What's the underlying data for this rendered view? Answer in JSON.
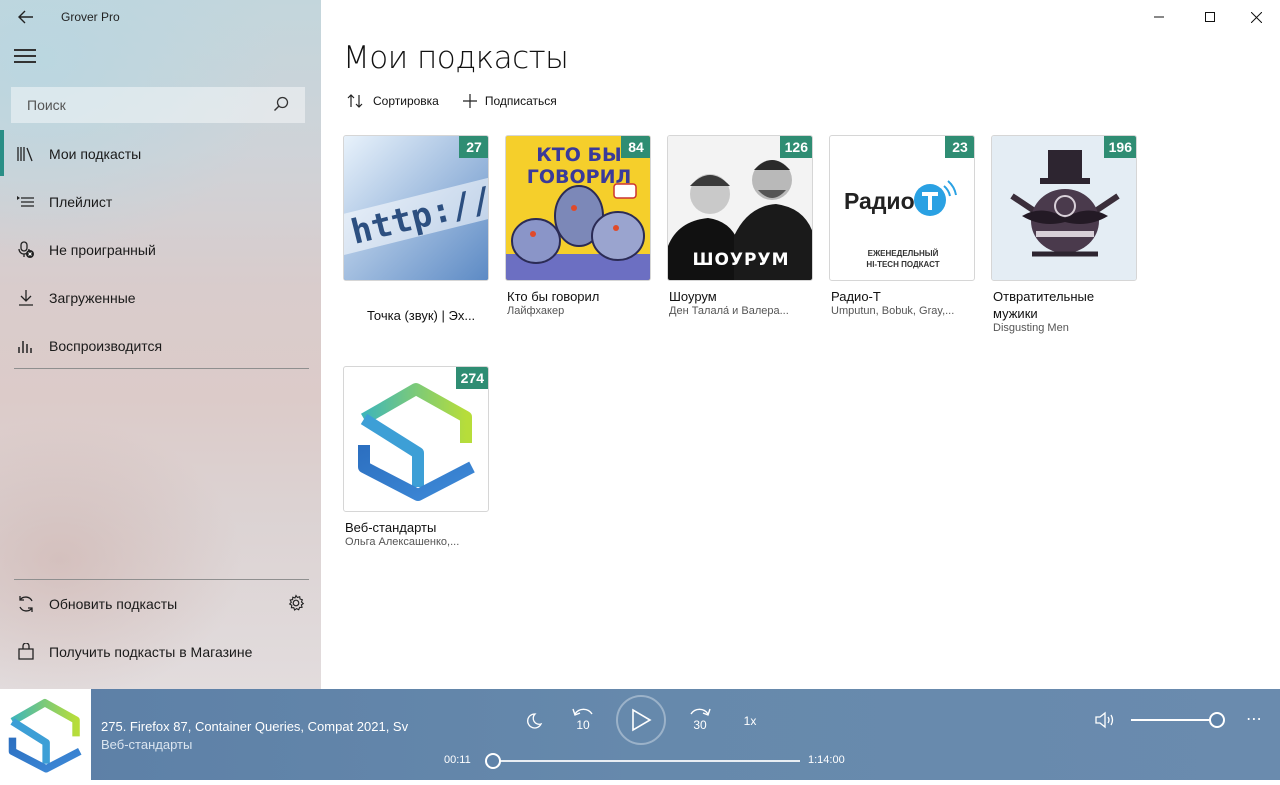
{
  "app": {
    "title": "Grover Pro"
  },
  "search": {
    "placeholder": "Поиск"
  },
  "nav": {
    "items": [
      {
        "label": "Мои подкасты",
        "icon": "library-icon"
      },
      {
        "label": "Плейлист",
        "icon": "playlist-icon"
      },
      {
        "label": "Не проигранный",
        "icon": "unplayed-icon"
      },
      {
        "label": "Загруженные",
        "icon": "download-icon"
      },
      {
        "label": "Воспроизводится",
        "icon": "equalizer-icon"
      }
    ],
    "bottom": [
      {
        "label": "Обновить подкасты",
        "icon": "refresh-icon"
      },
      {
        "label": "Получить подкасты в Магазине",
        "icon": "store-icon"
      }
    ]
  },
  "main": {
    "title": "Мои подкасты",
    "toolbar": {
      "sort_label": "Сортировка",
      "subscribe_label": "Подписаться"
    }
  },
  "podcasts": [
    {
      "title": "Точка (звук)  | Эх...",
      "subtitle": "",
      "count": "27"
    },
    {
      "title": "Кто бы говорил",
      "subtitle": "Лайфхакер",
      "count": "84",
      "cover_text": [
        "КТО БЫ",
        "ГОВОРИЛ"
      ]
    },
    {
      "title": "Шоурум",
      "subtitle": "Ден Талала́ и Валера...",
      "count": "126",
      "cover_text": "ШОУРУМ"
    },
    {
      "title": "Радио-Т",
      "subtitle": "Umputun, Bobuk, Gray,...",
      "count": "23",
      "cover_text": {
        "logo": "Радио",
        "line1": "ЕЖЕНЕДЕЛЬНЫЙ",
        "line2": "HI-TECH ПОДКАСТ"
      }
    },
    {
      "title": "Отвратительные мужики",
      "subtitle": "Disgusting Men",
      "count": "196"
    },
    {
      "title": "Веб-стандарты",
      "subtitle": "Ольга Алексашенко,...",
      "count": "274"
    }
  ],
  "player": {
    "title": "275. Firefox 87, Container Queries, Compat 2021, Sv",
    "subtitle": "Веб-стандарты",
    "elapsed": "00:11",
    "duration": "1:14:00",
    "rewind_label": "10",
    "forward_label": "30",
    "speed_label": "1x",
    "progress_fraction": 0.0025,
    "volume_fraction": 1.0
  },
  "colors": {
    "accent": "#2a8e86",
    "badge": "#2f8d73",
    "player_bg": "#6387ab"
  }
}
